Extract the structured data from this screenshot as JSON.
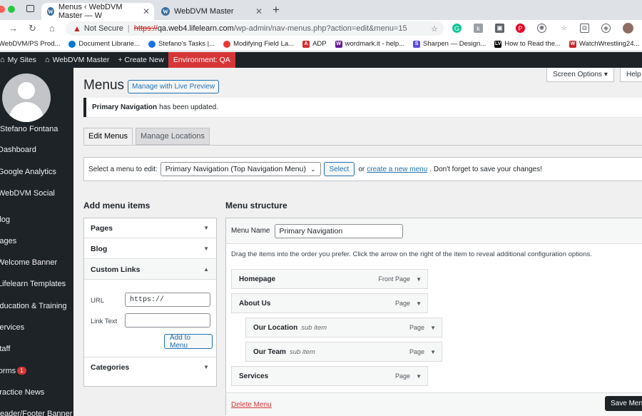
{
  "browser": {
    "tabs": [
      {
        "title": "Menus ‹ WebDVM Master — W",
        "favicon": "wordpress-icon"
      },
      {
        "title": "WebDVM Master",
        "favicon": "wordpress-icon"
      }
    ],
    "new_tab": "+",
    "address": {
      "warning": "Not Secure",
      "scheme": "https://",
      "host": "qa.web4.lifelearn.com",
      "path": "/wp-admin/nav-menus.php?action=edit&menu=15"
    },
    "bookmarks": [
      {
        "label": "WebDVM/PS Prod...",
        "color": "#888888"
      },
      {
        "label": "Document Librarie...",
        "color": "#0078d4"
      },
      {
        "label": "Stefano's Tasks |...",
        "color": "#1a73e8"
      },
      {
        "label": "Modifying Field La...",
        "color": "#e53935"
      },
      {
        "label": "ADP",
        "color": "#d32f2f"
      },
      {
        "label": "wordmark.it - help...",
        "color": "#6a1b9a"
      },
      {
        "label": "Sharpen — Design...",
        "color": "#5b4fe0"
      },
      {
        "label": "How to Read the...",
        "color": "#000000"
      },
      {
        "label": "WatchWrestling24...",
        "color": "#c62828"
      }
    ]
  },
  "adminbar": {
    "my_sites": "My Sites",
    "site_name": "WebDVM Master",
    "create_new": "+ Create New",
    "environment": "Environment: QA"
  },
  "sidebar": {
    "username": "Stefano Fontana",
    "items": [
      {
        "label": "Dashboard"
      },
      {
        "label": "Google Analytics"
      },
      {
        "label": "WebDVM Social"
      },
      {
        "label": "Blog"
      },
      {
        "label": "Pages"
      },
      {
        "label": "Welcome Banner"
      },
      {
        "label": "Lifelearn Templates"
      },
      {
        "label": "Education & Training"
      },
      {
        "label": "Services"
      },
      {
        "label": "Staff"
      },
      {
        "label": "Forms",
        "badge": "1"
      },
      {
        "label": "Practice News"
      },
      {
        "label": "Header/Footer Banner"
      }
    ]
  },
  "header": {
    "screen_options": "Screen Options ▾",
    "help": "Help",
    "title": "Menus",
    "live_preview": "Manage with Live Preview"
  },
  "notice": {
    "bold": "Primary Navigation",
    "text": "has been updated."
  },
  "tabs": [
    {
      "label": "Edit Menus",
      "active": true
    },
    {
      "label": "Manage Locations",
      "active": false
    }
  ],
  "select_bar": {
    "prompt": "Select a menu to edit:",
    "selected": "Primary Navigation (Top Navigation Menu)",
    "button": "Select",
    "or_text": "or",
    "create_link": "create a new menu",
    "suffix": ". Don't forget to save your changes!"
  },
  "add_items": {
    "title": "Add menu items",
    "sections": [
      {
        "label": "Pages",
        "open": false
      },
      {
        "label": "Blog",
        "open": false
      },
      {
        "label": "Custom Links",
        "open": true
      },
      {
        "label": "Categories",
        "open": false
      }
    ],
    "custom_links": {
      "url_label": "URL",
      "url_value": "https://",
      "text_label": "Link Text",
      "text_value": "",
      "add_button": "Add to Menu"
    }
  },
  "structure": {
    "title": "Menu structure",
    "name_label": "Menu Name",
    "name_value": "Primary Navigation",
    "instructions": "Drag the items into the order you prefer. Click the arrow on the right of the item to reveal additional configuration options.",
    "items": [
      {
        "title": "Homepage",
        "sub": "",
        "type": "Front Page",
        "depth": 0
      },
      {
        "title": "About Us",
        "sub": "",
        "type": "Page",
        "depth": 0
      },
      {
        "title": "Our Location",
        "sub": "sub item",
        "type": "Page",
        "depth": 1
      },
      {
        "title": "Our Team",
        "sub": "sub item",
        "type": "Page",
        "depth": 1
      },
      {
        "title": "Services",
        "sub": "",
        "type": "Page",
        "depth": 0
      }
    ],
    "delete_label": "Delete Menu",
    "save_label": "Save Menu"
  },
  "colors": {
    "admin_dark": "#1d2327",
    "accent_blue": "#2271b1",
    "env_red": "#d63638"
  }
}
